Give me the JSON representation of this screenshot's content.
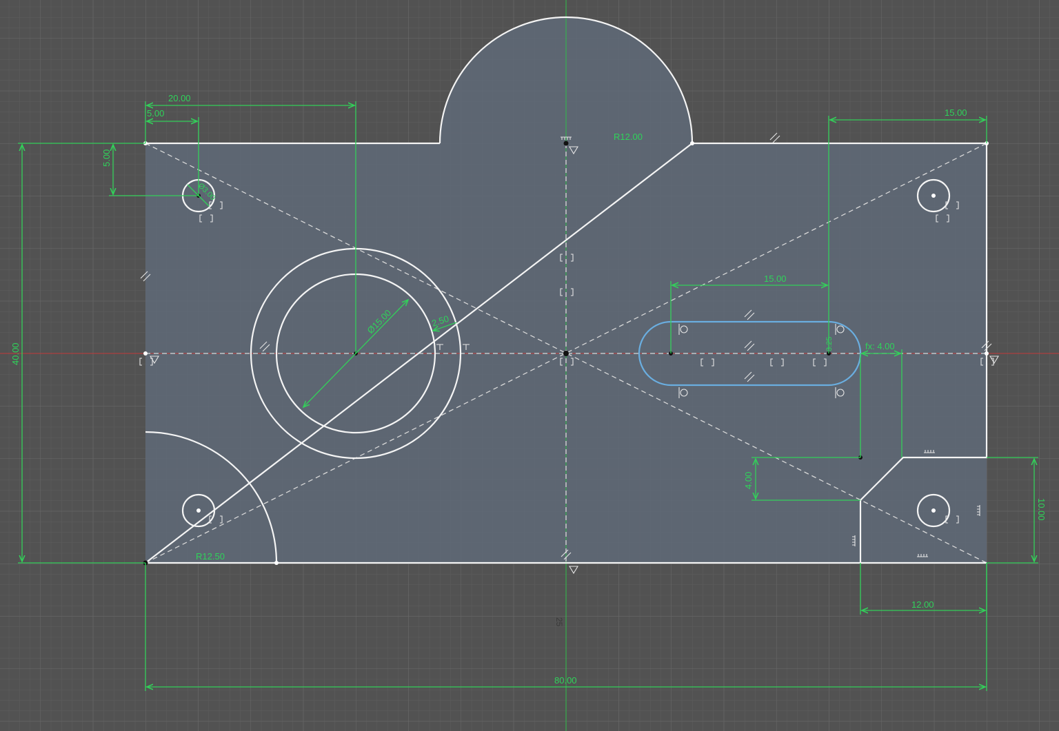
{
  "colors": {
    "background": "#525252",
    "grid_minor": "#5c5c5c",
    "grid_major": "#6b6b6b",
    "profile_fill": "#5f6a78",
    "geometry": "#f4f4f4",
    "dimension": "#2fd35a",
    "selected": "#6aaee0",
    "axis_x": "#c23a3a",
    "axis_y": "#2fbf4a"
  },
  "dimensions": {
    "width_total": "80.00",
    "height_total": "40.00",
    "hole_offset_x": "20.00",
    "small_hole_x": "5.00",
    "small_hole_y": "5.00",
    "small_hole_dia": "Ø3.00",
    "top_right_offset": "15.00",
    "top_arc_radius": "R12.00",
    "big_hole_dia": "Ø15.00",
    "ring_width": "2.50",
    "slot_length": "15.00",
    "slot_offset": "fx: 4.00",
    "slot_radius": "3.25",
    "corner_radius": "R12.50",
    "notch_height": "4.00",
    "corner_block_height": "10.00",
    "corner_block_width": "12.00",
    "center_offset": "25"
  },
  "icons": {
    "parallel": "parallel-constraint-icon",
    "coincident": "coincident-constraint-icon",
    "horizontal": "horizontal-constraint-icon",
    "fix": "fix-constraint-icon",
    "midpoint": "midpoint-constraint-icon",
    "tangent": "tangent-constraint-icon"
  }
}
